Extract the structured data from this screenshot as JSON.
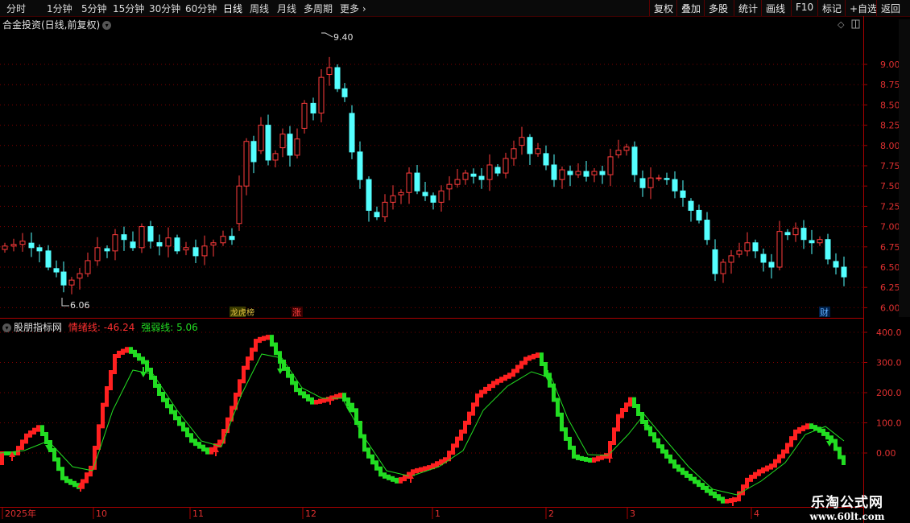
{
  "toolbar": {
    "periods": [
      "分时",
      "1分钟",
      "5分钟",
      "15分钟",
      "30分钟",
      "60分钟",
      "日线",
      "周线",
      "月线",
      "多周期",
      "更多"
    ],
    "active_period": "日线",
    "right_buttons": [
      "复权",
      "叠加",
      "多股",
      "统计",
      "画线",
      "F10",
      "标记",
      "+自选",
      "返回"
    ]
  },
  "main_pane": {
    "title": "合金投资(日线,前复权)",
    "price_ticks": [
      "9.00",
      "8.75",
      "8.50",
      "8.25",
      "8.00",
      "7.75",
      "7.50",
      "7.25",
      "7.00",
      "6.75",
      "6.50",
      "6.25",
      "6.00"
    ],
    "high_label": "9.40",
    "low_label": "6.06",
    "markers": [
      {
        "text": "龙虎榜",
        "color": "#e0c040"
      },
      {
        "text": "涨",
        "color": "#ff4040"
      },
      {
        "text": "财",
        "color": "#40a0ff"
      }
    ]
  },
  "indicator_pane": {
    "name": "股朋指标网",
    "line1_label": "情绪线: -46.24",
    "line2_label": "强弱线: 5.06",
    "ticks": [
      "400.0",
      "300.0",
      "200.0",
      "100.0",
      "0.00"
    ]
  },
  "time_axis": [
    "2025年",
    "10",
    "11",
    "12",
    "1",
    "2",
    "3",
    "4"
  ],
  "watermark": {
    "line1": "乐淘公式网",
    "line2": "www.60lt.com"
  },
  "colors": {
    "up": "#ff3c3c",
    "down": "#54ffff",
    "grid": "#7a0000",
    "ind_up": "#ff2020",
    "ind_down": "#22dd22",
    "strength": "#22dd22",
    "axis": "#aa0000"
  }
}
